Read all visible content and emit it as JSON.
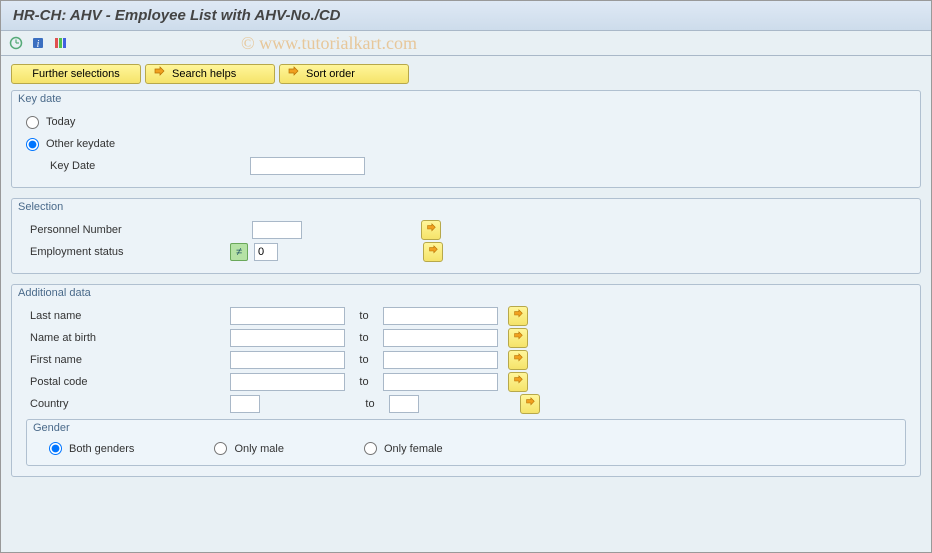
{
  "title": "HR-CH:  AHV - Employee List with AHV-No./CD",
  "watermark": "© www.tutorialkart.com",
  "buttons": {
    "further": "Further selections",
    "search": "Search helps",
    "sort": "Sort order"
  },
  "groups": {
    "keydate": {
      "title": "Key date",
      "today": "Today",
      "other": "Other keydate",
      "keydate_label": "Key Date",
      "keydate_value": ""
    },
    "selection": {
      "title": "Selection",
      "pernr_label": "Personnel Number",
      "pernr_value": "",
      "empstat_label": "Employment status",
      "empstat_value": "0"
    },
    "additional": {
      "title": "Additional data",
      "to": "to",
      "lastname": {
        "label": "Last name",
        "low": "",
        "high": ""
      },
      "nameatbirth": {
        "label": "Name at birth",
        "low": "",
        "high": ""
      },
      "firstname": {
        "label": "First name",
        "low": "",
        "high": ""
      },
      "postal": {
        "label": "Postal code",
        "low": "",
        "high": ""
      },
      "country": {
        "label": "Country",
        "low": "",
        "high": ""
      },
      "gender": {
        "title": "Gender",
        "both": "Both genders",
        "male": "Only male",
        "female": "Only female"
      }
    }
  }
}
